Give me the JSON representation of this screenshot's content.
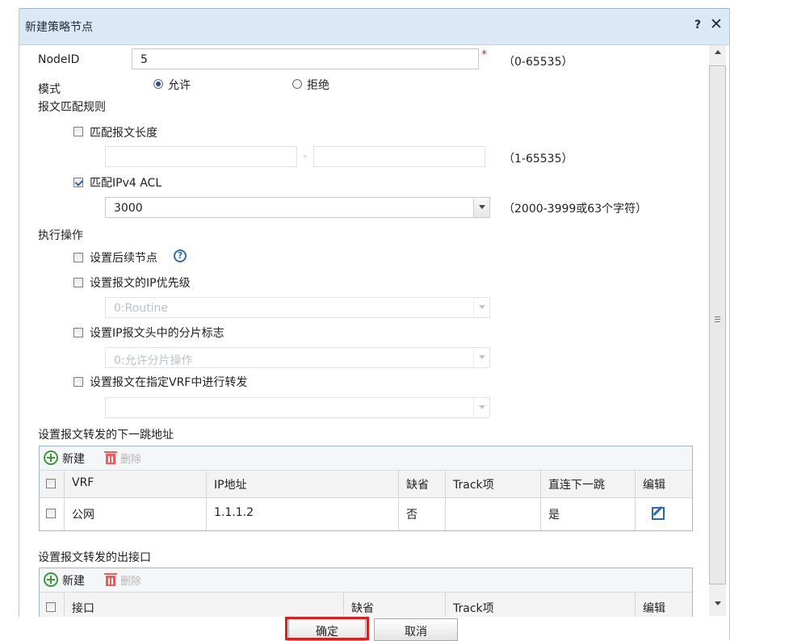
{
  "dialog": {
    "title": "新建策略节点",
    "help": "?",
    "close": "✕"
  },
  "node_id": {
    "label": "NodeID",
    "value": "5",
    "required_mark": "*",
    "range": "（0-65535）"
  },
  "mode": {
    "label": "模式",
    "options": [
      "允许",
      "拒绝"
    ],
    "selected": "允许"
  },
  "match_rules": {
    "heading": "报文匹配规则",
    "match_length": {
      "label": "匹配报文长度",
      "checked": false,
      "separator": "-",
      "range": "（1-65535）"
    },
    "match_acl": {
      "label": "匹配IPv4 ACL",
      "checked": true,
      "value": "3000",
      "range": "（2000-3999或63个字符）"
    }
  },
  "actions": {
    "heading": "执行操作",
    "next_node": {
      "label": "设置后续节点",
      "checked": false,
      "help_icon": "?"
    },
    "ip_precedence": {
      "label": "设置报文的IP优先级",
      "checked": false,
      "placeholder": "0:Routine"
    },
    "fragment": {
      "label": "设置IP报文头中的分片标志",
      "checked": false,
      "placeholder": "0:允许分片操作"
    },
    "vrf_forward": {
      "label": "设置报文在指定VRF中进行转发",
      "checked": false,
      "placeholder": ""
    }
  },
  "next_hop": {
    "heading": "设置报文转发的下一跳地址",
    "toolbar": {
      "add": "新建",
      "delete": "删除"
    },
    "columns": [
      "VRF",
      "IP地址",
      "缺省",
      "Track项",
      "直连下一跳",
      "编辑"
    ],
    "rows": [
      {
        "vrf": "公网",
        "ip": "1.1.1.2",
        "default": "否",
        "track": "",
        "direct": "是"
      }
    ]
  },
  "out_interface": {
    "heading": "设置报文转发的出接口",
    "toolbar": {
      "add": "新建",
      "delete": "删除"
    },
    "columns": [
      "接口",
      "缺省",
      "Track项",
      "编辑"
    ]
  },
  "buttons": {
    "ok": "确定",
    "cancel": "取消"
  },
  "colors": {
    "titlebar": "#dbe9f6",
    "highlight": "#e21a1a",
    "accent": "#2a5fa8"
  }
}
